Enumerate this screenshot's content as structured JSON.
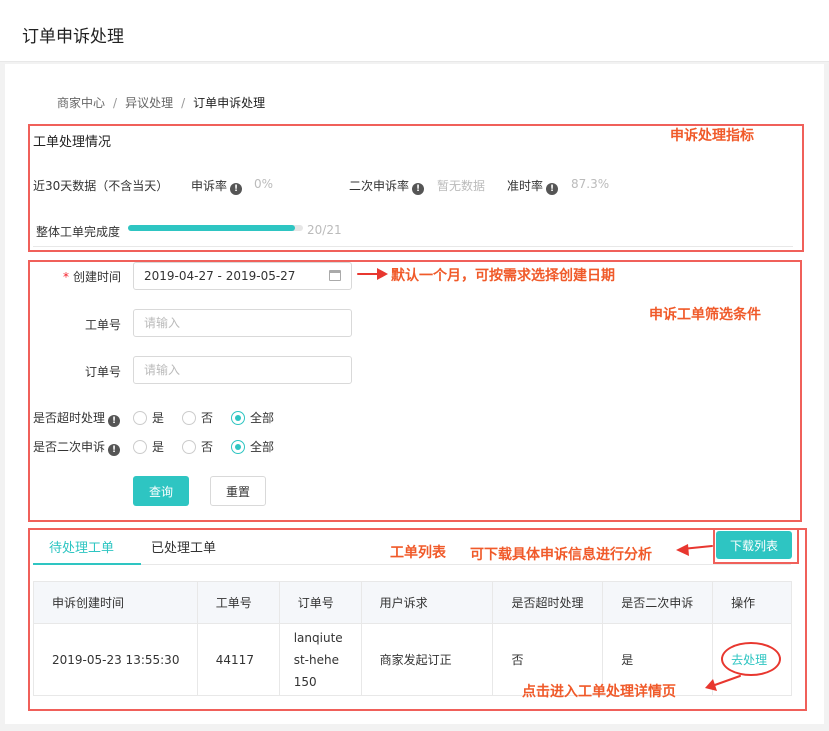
{
  "page": {
    "title": "订单申诉处理"
  },
  "breadcrumb": {
    "items": [
      "商家中心",
      "异议处理"
    ],
    "current": "订单申诉处理",
    "separator": "/"
  },
  "stats": {
    "section_title": "工单处理情况",
    "period_label": "近30天数据（不含当天）",
    "appeal_rate_label": "申诉率",
    "appeal_rate_value": "0%",
    "second_appeal_label": "二次申诉率",
    "second_appeal_value": "暂无数据",
    "ontime_label": "准时率",
    "ontime_value": "87.3%",
    "completion_label": "整体工单完成度",
    "completion_text": "20/21",
    "completion_fraction": 0.952
  },
  "filters": {
    "created_label": "创建时间",
    "created_value": "2019-04-27 - 2019-05-27",
    "ticket_label": "工单号",
    "ticket_placeholder": "请输入",
    "order_label": "订单号",
    "order_placeholder": "请输入",
    "timeout_label": "是否超时处理",
    "second_label": "是否二次申诉",
    "options": [
      "是",
      "否",
      "全部"
    ],
    "query_button": "查询",
    "reset_button": "重置"
  },
  "tabs": [
    {
      "label": "待处理工单"
    },
    {
      "label": "已处理工单"
    }
  ],
  "download_button": "下载列表",
  "table": {
    "headers": [
      "申诉创建时间",
      "工单号",
      "订单号",
      "用户诉求",
      "是否超时处理",
      "是否二次申诉",
      "操作"
    ],
    "rows": [
      {
        "created": "2019-05-23 13:55:30",
        "ticket": "44117",
        "order_lines": [
          "lanqiute",
          "st-hehe",
          "150"
        ],
        "demand": "商家发起订正",
        "timeout": "否",
        "second": "是",
        "action": "去处理"
      }
    ]
  },
  "annotations": {
    "metrics": "申诉处理指标",
    "default_month": "默认一个月，可按需求选择创建日期",
    "filter_conditions": "申诉工单筛选条件",
    "ticket_list": "工单列表",
    "download_hint": "可下载具体申诉信息进行分析",
    "detail_hint": "点击进入工单处理详情页"
  },
  "colors": {
    "accent": "#2ec5c2",
    "annotation": "#f05a2a",
    "box": "#f0605a"
  }
}
